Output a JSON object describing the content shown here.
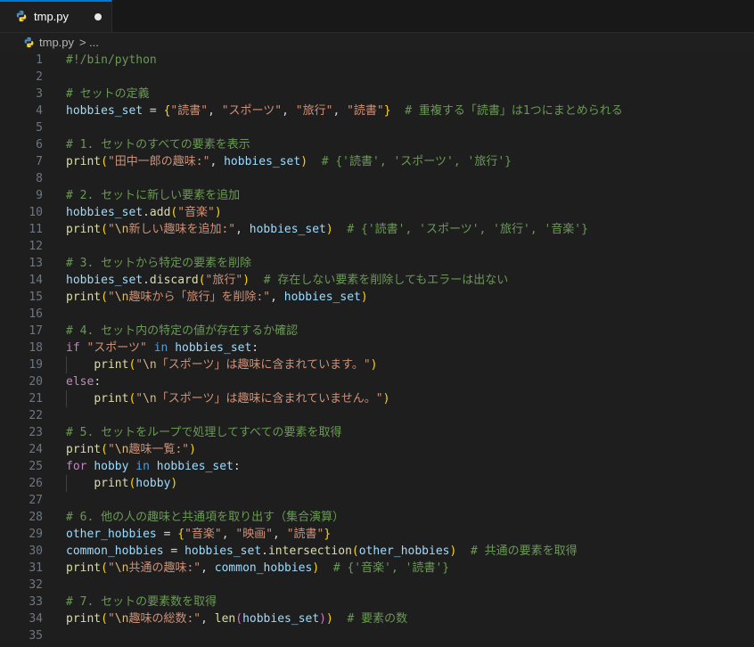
{
  "tab": {
    "filename": "tmp.py",
    "icon": "python-icon",
    "modified": true
  },
  "breadcrumb": {
    "file": "tmp.py",
    "separator": ">",
    "more": "..."
  },
  "editor": {
    "lines": [
      [
        {
          "t": "c",
          "v": "#!/bin/python"
        }
      ],
      [],
      [
        {
          "t": "c",
          "v": "# セットの定義"
        }
      ],
      [
        {
          "t": "v",
          "v": "hobbies_set"
        },
        {
          "t": "p",
          "v": " = "
        },
        {
          "t": "b1",
          "v": "{"
        },
        {
          "t": "s",
          "v": "\"読書\""
        },
        {
          "t": "p",
          "v": ", "
        },
        {
          "t": "s",
          "v": "\"スポーツ\""
        },
        {
          "t": "p",
          "v": ", "
        },
        {
          "t": "s",
          "v": "\"旅行\""
        },
        {
          "t": "p",
          "v": ", "
        },
        {
          "t": "s",
          "v": "\"読書\""
        },
        {
          "t": "b1",
          "v": "}"
        },
        {
          "t": "p",
          "v": "  "
        },
        {
          "t": "c",
          "v": "# 重複する「読書」は1つにまとめられる"
        }
      ],
      [],
      [
        {
          "t": "c",
          "v": "# 1. セットのすべての要素を表示"
        }
      ],
      [
        {
          "t": "f",
          "v": "print"
        },
        {
          "t": "b1",
          "v": "("
        },
        {
          "t": "s",
          "v": "\"田中一郎の趣味:\""
        },
        {
          "t": "p",
          "v": ", "
        },
        {
          "t": "v",
          "v": "hobbies_set"
        },
        {
          "t": "b1",
          "v": ")"
        },
        {
          "t": "p",
          "v": "  "
        },
        {
          "t": "c",
          "v": "# {'読書', 'スポーツ', '旅行'}"
        }
      ],
      [],
      [
        {
          "t": "c",
          "v": "# 2. セットに新しい要素を追加"
        }
      ],
      [
        {
          "t": "v",
          "v": "hobbies_set"
        },
        {
          "t": "p",
          "v": "."
        },
        {
          "t": "f",
          "v": "add"
        },
        {
          "t": "b1",
          "v": "("
        },
        {
          "t": "s",
          "v": "\"音楽\""
        },
        {
          "t": "b1",
          "v": ")"
        }
      ],
      [
        {
          "t": "f",
          "v": "print"
        },
        {
          "t": "b1",
          "v": "("
        },
        {
          "t": "s",
          "v": "\""
        },
        {
          "t": "e",
          "v": "\\n"
        },
        {
          "t": "s",
          "v": "新しい趣味を追加:\""
        },
        {
          "t": "p",
          "v": ", "
        },
        {
          "t": "v",
          "v": "hobbies_set"
        },
        {
          "t": "b1",
          "v": ")"
        },
        {
          "t": "p",
          "v": "  "
        },
        {
          "t": "c",
          "v": "# {'読書', 'スポーツ', '旅行', '音楽'}"
        }
      ],
      [],
      [
        {
          "t": "c",
          "v": "# 3. セットから特定の要素を削除"
        }
      ],
      [
        {
          "t": "v",
          "v": "hobbies_set"
        },
        {
          "t": "p",
          "v": "."
        },
        {
          "t": "f",
          "v": "discard"
        },
        {
          "t": "b1",
          "v": "("
        },
        {
          "t": "s",
          "v": "\"旅行\""
        },
        {
          "t": "b1",
          "v": ")"
        },
        {
          "t": "p",
          "v": "  "
        },
        {
          "t": "c",
          "v": "# 存在しない要素を削除してもエラーは出ない"
        }
      ],
      [
        {
          "t": "f",
          "v": "print"
        },
        {
          "t": "b1",
          "v": "("
        },
        {
          "t": "s",
          "v": "\""
        },
        {
          "t": "e",
          "v": "\\n"
        },
        {
          "t": "s",
          "v": "趣味から「旅行」を削除:\""
        },
        {
          "t": "p",
          "v": ", "
        },
        {
          "t": "v",
          "v": "hobbies_set"
        },
        {
          "t": "b1",
          "v": ")"
        }
      ],
      [],
      [
        {
          "t": "c",
          "v": "# 4. セット内の特定の値が存在するか確認"
        }
      ],
      [
        {
          "t": "k",
          "v": "if"
        },
        {
          "t": "p",
          "v": " "
        },
        {
          "t": "s",
          "v": "\"スポーツ\""
        },
        {
          "t": "p",
          "v": " "
        },
        {
          "t": "kb",
          "v": "in"
        },
        {
          "t": "p",
          "v": " "
        },
        {
          "t": "v",
          "v": "hobbies_set"
        },
        {
          "t": "p",
          "v": ":"
        }
      ],
      [
        {
          "t": "p",
          "v": "    "
        },
        {
          "t": "f",
          "v": "print"
        },
        {
          "t": "b1",
          "v": "("
        },
        {
          "t": "s",
          "v": "\""
        },
        {
          "t": "e",
          "v": "\\n"
        },
        {
          "t": "s",
          "v": "「スポーツ」は趣味に含まれています。\""
        },
        {
          "t": "b1",
          "v": ")"
        }
      ],
      [
        {
          "t": "k",
          "v": "else"
        },
        {
          "t": "p",
          "v": ":"
        }
      ],
      [
        {
          "t": "p",
          "v": "    "
        },
        {
          "t": "f",
          "v": "print"
        },
        {
          "t": "b1",
          "v": "("
        },
        {
          "t": "s",
          "v": "\""
        },
        {
          "t": "e",
          "v": "\\n"
        },
        {
          "t": "s",
          "v": "「スポーツ」は趣味に含まれていません。\""
        },
        {
          "t": "b1",
          "v": ")"
        }
      ],
      [],
      [
        {
          "t": "c",
          "v": "# 5. セットをループで処理してすべての要素を取得"
        }
      ],
      [
        {
          "t": "f",
          "v": "print"
        },
        {
          "t": "b1",
          "v": "("
        },
        {
          "t": "s",
          "v": "\""
        },
        {
          "t": "e",
          "v": "\\n"
        },
        {
          "t": "s",
          "v": "趣味一覧:\""
        },
        {
          "t": "b1",
          "v": ")"
        }
      ],
      [
        {
          "t": "k",
          "v": "for"
        },
        {
          "t": "p",
          "v": " "
        },
        {
          "t": "v",
          "v": "hobby"
        },
        {
          "t": "p",
          "v": " "
        },
        {
          "t": "kb",
          "v": "in"
        },
        {
          "t": "p",
          "v": " "
        },
        {
          "t": "v",
          "v": "hobbies_set"
        },
        {
          "t": "p",
          "v": ":"
        }
      ],
      [
        {
          "t": "p",
          "v": "    "
        },
        {
          "t": "f",
          "v": "print"
        },
        {
          "t": "b1",
          "v": "("
        },
        {
          "t": "v",
          "v": "hobby"
        },
        {
          "t": "b1",
          "v": ")"
        }
      ],
      [],
      [
        {
          "t": "c",
          "v": "# 6. 他の人の趣味と共通項を取り出す（集合演算）"
        }
      ],
      [
        {
          "t": "v",
          "v": "other_hobbies"
        },
        {
          "t": "p",
          "v": " = "
        },
        {
          "t": "b1",
          "v": "{"
        },
        {
          "t": "s",
          "v": "\"音楽\""
        },
        {
          "t": "p",
          "v": ", "
        },
        {
          "t": "s",
          "v": "\"映画\""
        },
        {
          "t": "p",
          "v": ", "
        },
        {
          "t": "s",
          "v": "\"読書\""
        },
        {
          "t": "b1",
          "v": "}"
        }
      ],
      [
        {
          "t": "v",
          "v": "common_hobbies"
        },
        {
          "t": "p",
          "v": " = "
        },
        {
          "t": "v",
          "v": "hobbies_set"
        },
        {
          "t": "p",
          "v": "."
        },
        {
          "t": "f",
          "v": "intersection"
        },
        {
          "t": "b1",
          "v": "("
        },
        {
          "t": "v",
          "v": "other_hobbies"
        },
        {
          "t": "b1",
          "v": ")"
        },
        {
          "t": "p",
          "v": "  "
        },
        {
          "t": "c",
          "v": "# 共通の要素を取得"
        }
      ],
      [
        {
          "t": "f",
          "v": "print"
        },
        {
          "t": "b1",
          "v": "("
        },
        {
          "t": "s",
          "v": "\""
        },
        {
          "t": "e",
          "v": "\\n"
        },
        {
          "t": "s",
          "v": "共通の趣味:\""
        },
        {
          "t": "p",
          "v": ", "
        },
        {
          "t": "v",
          "v": "common_hobbies"
        },
        {
          "t": "b1",
          "v": ")"
        },
        {
          "t": "p",
          "v": "  "
        },
        {
          "t": "c",
          "v": "# {'音楽', '読書'}"
        }
      ],
      [],
      [
        {
          "t": "c",
          "v": "# 7. セットの要素数を取得"
        }
      ],
      [
        {
          "t": "f",
          "v": "print"
        },
        {
          "t": "b1",
          "v": "("
        },
        {
          "t": "s",
          "v": "\""
        },
        {
          "t": "e",
          "v": "\\n"
        },
        {
          "t": "s",
          "v": "趣味の総数:\""
        },
        {
          "t": "p",
          "v": ", "
        },
        {
          "t": "f",
          "v": "len"
        },
        {
          "t": "b2",
          "v": "("
        },
        {
          "t": "v",
          "v": "hobbies_set"
        },
        {
          "t": "b2",
          "v": ")"
        },
        {
          "t": "b1",
          "v": ")"
        },
        {
          "t": "p",
          "v": "  "
        },
        {
          "t": "c",
          "v": "# 要素の数"
        }
      ],
      []
    ],
    "indent_guides": [
      19,
      21,
      26
    ]
  }
}
